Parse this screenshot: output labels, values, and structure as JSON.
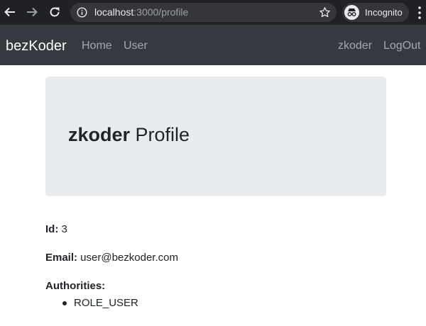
{
  "browser": {
    "url_host": "localhost",
    "url_path": ":3000/profile",
    "incognito_label": "Incognito"
  },
  "navbar": {
    "brand": "bezKoder",
    "links": [
      "Home",
      "User"
    ],
    "username": "zkoder",
    "logout": "LogOut"
  },
  "profile": {
    "username": "zkoder",
    "title_suffix": " Profile",
    "id_label": "Id:",
    "id_value": " 3",
    "email_label": "Email:",
    "email_value": " user@bezkoder.com",
    "authorities_label": "Authorities:",
    "authorities": [
      "ROLE_USER"
    ]
  },
  "colors": {
    "navbar_bg": "#343a40",
    "jumbotron_bg": "#e9ecef",
    "chrome_bg": "#202124"
  }
}
